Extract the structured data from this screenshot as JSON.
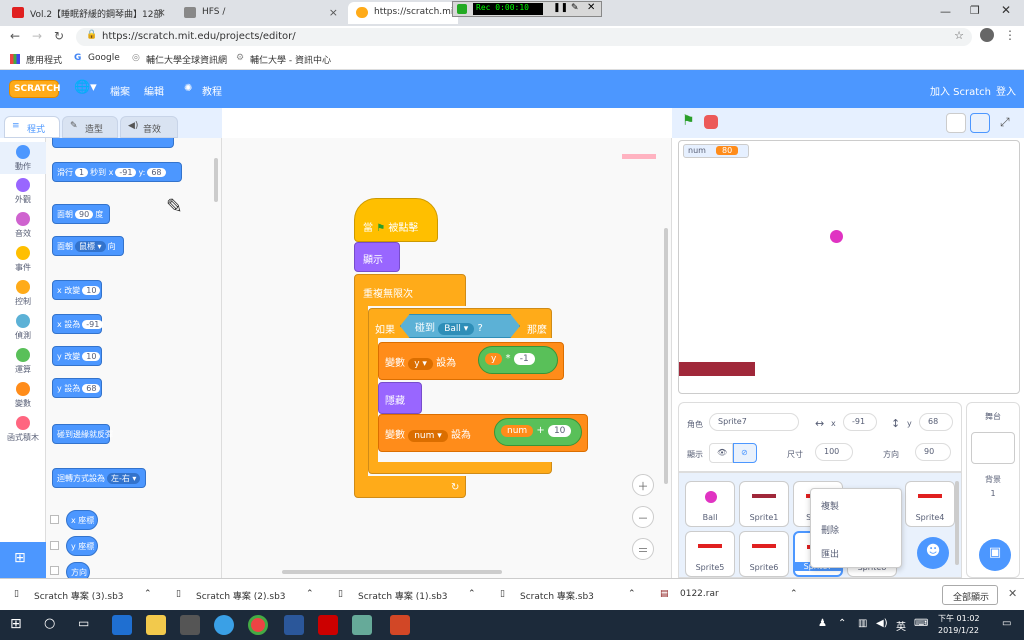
{
  "browser": {
    "tabs": [
      {
        "label": "Vol.2【睡眠舒緩的鋼琴曲】12部"
      },
      {
        "label": "HFS /"
      },
      {
        "label": "https://scratch.mit.e"
      }
    ],
    "url": "https://scratch.mit.edu/projects/editor/",
    "bookmarks": [
      "應用程式",
      "Google",
      "輔仁大學全球資訊網",
      "輔仁大學 - 資訊中心"
    ],
    "recorder": "Rec 0:00:10"
  },
  "menu": {
    "logo": "SCRATCH",
    "file": "檔案",
    "edit": "編輯",
    "tutorial": "教程",
    "join": "加入 Scratch",
    "signin": "登入"
  },
  "editor_tabs": {
    "code": "程式",
    "costumes": "造型",
    "sounds": "音效"
  },
  "categories": [
    {
      "label": "動作",
      "color": "#4c97ff"
    },
    {
      "label": "外觀",
      "color": "#9966ff"
    },
    {
      "label": "音效",
      "color": "#cf63cf"
    },
    {
      "label": "事件",
      "color": "#ffbf00"
    },
    {
      "label": "控制",
      "color": "#ffab19"
    },
    {
      "label": "偵測",
      "color": "#5cb1d6"
    },
    {
      "label": "運算",
      "color": "#59c059"
    },
    {
      "label": "變數",
      "color": "#ff8c1a"
    },
    {
      "label": "函式積木",
      "color": "#ff6680"
    }
  ],
  "palette": {
    "glide_prefix": "滑行",
    "glide_secs": "1",
    "glide_mid": "秒到 x",
    "glide_x": "-91",
    "glide_y_label": "y:",
    "glide_y": "68",
    "point_prefix": "面朝",
    "point_val": "90",
    "point_suffix": "度",
    "point_towards": "面朝",
    "point_target": "鼠標 ▾",
    "point_towards_suffix": "向",
    "changex": "x 改變",
    "changex_val": "10",
    "setx": "x 設為",
    "setx_val": "-91",
    "changey": "y 改變",
    "changey_val": "10",
    "sety": "y 設為",
    "sety_val": "68",
    "bounce": "碰到邊緣就反彈",
    "rotation": "迴轉方式設為",
    "rotation_val": "左-右 ▾",
    "xpos": "x 座標",
    "ypos": "y 座標",
    "dir": "方向"
  },
  "script": {
    "hat": "當",
    "hat_suffix": "被點擊",
    "show": "顯示",
    "forever": "重複無限次",
    "if": "如果",
    "then": "那麼",
    "touching": "碰到",
    "touching_target": "Ball ▾",
    "touching_q": "?",
    "setvar": "變數",
    "var_y": "y ▾",
    "set_to": "設為",
    "reporter_y": "y",
    "mul": "*",
    "mul_val": "-1",
    "hide": "隱藏",
    "var_num": "num ▾",
    "reporter_num": "num",
    "plus": "+",
    "plus_val": "10",
    "loop_arrow": "↻"
  },
  "stage": {
    "monitor_label": "num",
    "monitor_value": "80"
  },
  "sprite_info": {
    "sprite_label": "角色",
    "sprite_name": "Sprite7",
    "x_label": "x",
    "x": "-91",
    "y_label": "y",
    "y": "68",
    "show_label": "顯示",
    "size_label": "尺寸",
    "size": "100",
    "dir_label": "方向",
    "dir": "90"
  },
  "sprites": [
    "Ball",
    "Sprite1",
    "Sprite",
    "Sprite4",
    "Sprite5",
    "Sprite6",
    "Sprite7",
    "Sprite8"
  ],
  "context_menu": [
    "複製",
    "刪除",
    "匯出"
  ],
  "stage_pane": {
    "title": "舞台",
    "backdrops_label": "背景",
    "backdrops_count": "1"
  },
  "downloads": {
    "items": [
      "Scratch 專案 (3).sb3",
      "Scratch 專案 (2).sb3",
      "Scratch 專案 (1).sb3",
      "Scratch 專案.sb3",
      "0122.rar"
    ],
    "show_all": "全部顯示"
  },
  "taskbar": {
    "time": "下午 01:02",
    "date": "2019/1/22",
    "lang": "英"
  }
}
